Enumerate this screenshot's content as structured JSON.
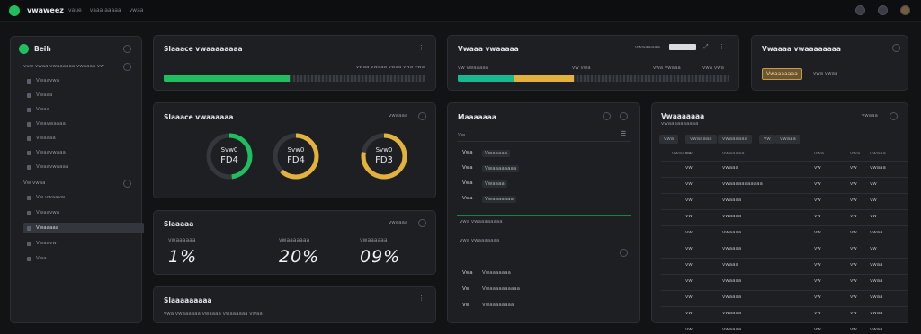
{
  "app": {
    "name": "vwaweez",
    "nav": [
      "vaue",
      "vaaa aaaaa",
      "vwaa"
    ]
  },
  "sidebar": {
    "title": "Beih",
    "section1_label": "vuw vwaa vwaaaaaa vwaaaa vw",
    "items": [
      {
        "label": "Vwaavwa"
      },
      {
        "label": "Vwaaa"
      },
      {
        "label": "Vwaa"
      },
      {
        "label": "Vwavwaaaa"
      },
      {
        "label": "Vwaaaa"
      },
      {
        "label": "Vwaavwaaa"
      },
      {
        "label": "Vwaavwaaaa"
      }
    ],
    "section2_label": "Vw vwaa",
    "items2": [
      {
        "label": "Vw vwaavw"
      },
      {
        "label": "Vwaavwa"
      },
      {
        "label": "Vwaaaaa",
        "active": true
      },
      {
        "label": "Vwaavw"
      },
      {
        "label": "Vwa"
      }
    ]
  },
  "progress1": {
    "title": "Slaaace vwaaaaaaaa",
    "caption": "vwaa vwaaa vwaa vwa vwa",
    "percent": 0.48,
    "color": "#1fbf5f"
  },
  "progress2": {
    "title": "Vwaaa vwaaaaa",
    "control": "vwaaaaaa",
    "labels": [
      "vw vwaaaaa",
      "vw vwa",
      "vwa vwaaa",
      "vwa vwa"
    ],
    "segments": [
      {
        "frac": 0.21,
        "color": "#18b890"
      },
      {
        "frac": 0.22,
        "color": "#e3b23c"
      }
    ]
  },
  "status_small": {
    "title": "Vwaaaa vwaaaaaaaa",
    "badge": "Vwaaaaaaa",
    "badge_text": "vwa vwaa"
  },
  "rings": {
    "title": "Slaaace vwaaaaaa",
    "control": "vwaaaa",
    "items": [
      {
        "label": "Svw0",
        "value": "FD4",
        "pct": 0.48,
        "color": "#1fbf5f"
      },
      {
        "label": "Svw0",
        "value": "FD4",
        "pct": 0.62,
        "color": "#e3b23c"
      },
      {
        "label": "Svw0",
        "value": "FD3",
        "pct": 0.78,
        "color": "#e3b23c"
      }
    ]
  },
  "stats": {
    "title": "Slaaaaa",
    "control": "vwaaaa",
    "items": [
      {
        "label": "vwaaaaaa",
        "value": "1%"
      },
      {
        "label": "vwaaaaaaa",
        "value": "20%"
      },
      {
        "label": "vwaaaaaa",
        "value": "09%"
      }
    ]
  },
  "footer_panel": {
    "title": "Slaaaaaaaaa",
    "caption": "vwa vwaaaaaa vwaaaa vwaaaaaa vwaa"
  },
  "list_panel": {
    "title": "Maaaaaaa",
    "header_key": "Vw",
    "rows": [
      {
        "k": "Vwa",
        "v": "Vwaaaaa"
      },
      {
        "k": "Vwa",
        "v": "Vwaaaaaaaa"
      },
      {
        "k": "Vwa",
        "v": "Vwaaaa"
      },
      {
        "k": "Vwa",
        "v": "Vwaaaaaaa"
      }
    ],
    "note1": "vwa vwaaaaaaaa",
    "note2": "vwa vwaaaaaaa",
    "rows2": [
      {
        "k": "Vwa",
        "v": "Vwaaaaaaa"
      },
      {
        "k": "Vw",
        "v": "Vwaaaaaaaaaa"
      },
      {
        "k": "Vw",
        "v": "Vwaaaaaaaa"
      }
    ]
  },
  "table_panel": {
    "title": "Vwaaaaaaa",
    "subtitle": "vwaaaaaaaaaa",
    "control": "vwaaa",
    "chips": [
      "vwa",
      "vwaaaaa",
      "vwaaaaaa",
      "vw",
      "vwaaa"
    ],
    "headers": [
      "vwaaaa",
      "vw",
      "vwaaaaa",
      "vwa",
      "vwa",
      "vwaaa"
    ],
    "rows": [
      [
        "vw",
        "vwaaa",
        "vw",
        "vw",
        "vwaaa"
      ],
      [
        "vw",
        "vwaaaaaaaaaaa",
        "vw",
        "vw",
        "vw"
      ],
      [
        "vw",
        "vwaaaa",
        "vw",
        "vw",
        "vw"
      ],
      [
        "vw",
        "vwaaaa",
        "vw",
        "vw",
        "vw"
      ],
      [
        "vw",
        "vwaaaa",
        "vw",
        "vw",
        "vwaa"
      ],
      [
        "vw",
        "vwaaaa",
        "vw",
        "vw",
        "vw"
      ],
      [
        "vw",
        "vwaaa",
        "vw",
        "vw",
        "vwaa"
      ],
      [
        "vw",
        "vwaaaa",
        "vw",
        "vw",
        "vwaa"
      ],
      [
        "vw",
        "vwaaaa",
        "vw",
        "vw",
        "vwaa"
      ],
      [
        "vw",
        "vwaaaa",
        "vw",
        "vw",
        "vwaa"
      ],
      [
        "vw",
        "vwaaaa",
        "vw",
        "vw",
        "vwaa"
      ]
    ]
  }
}
